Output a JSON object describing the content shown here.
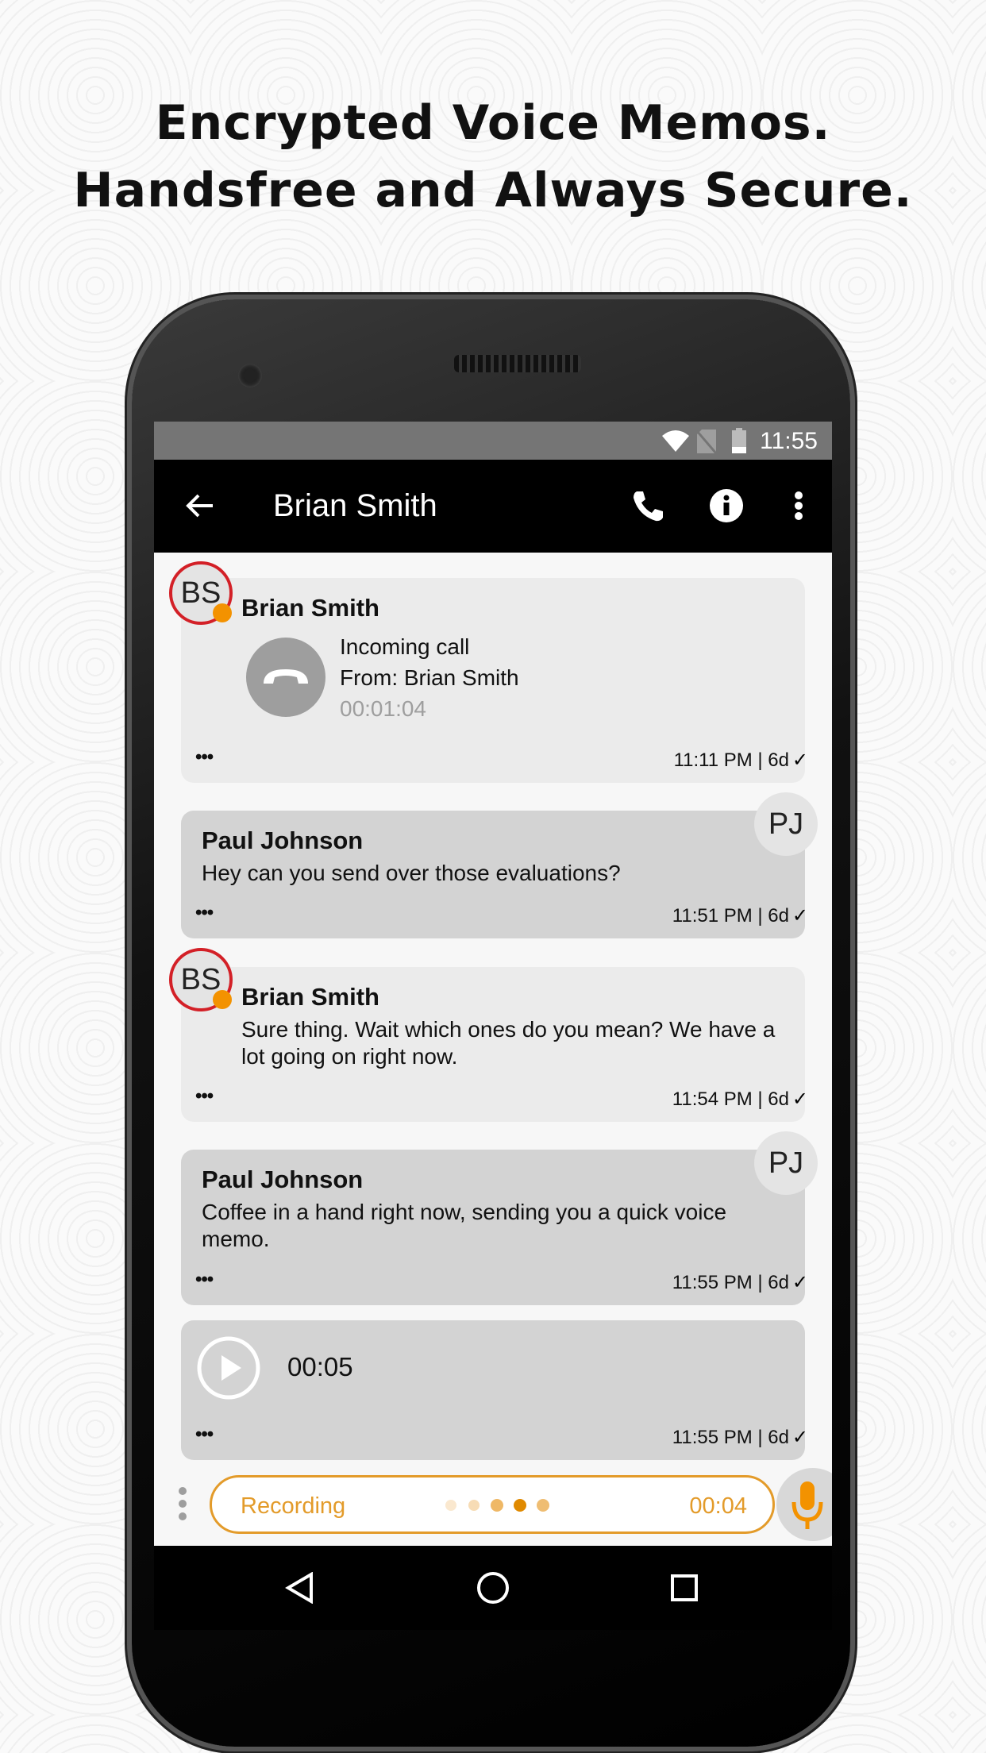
{
  "headline": {
    "line1": "Encrypted Voice Memos.",
    "line2": "Handsfree and Always Secure."
  },
  "status_bar": {
    "time": "11:55",
    "icons": [
      "wifi-icon",
      "no-sim-icon",
      "battery-icon"
    ]
  },
  "app_bar": {
    "title": "Brian Smith",
    "icons": [
      "back-arrow-icon",
      "phone-icon",
      "info-icon",
      "more-vert-icon"
    ]
  },
  "messages": [
    {
      "sender": "Brian Smith",
      "initials": "BS",
      "type": "call",
      "line1": "Incoming call",
      "line2": "From: Brian Smith",
      "duration": "00:01:04",
      "timestamp": "11:11 PM | 6d",
      "more": "•••"
    },
    {
      "sender": "Paul Johnson",
      "initials": "PJ",
      "text": "Hey can you send over those evaluations?",
      "timestamp": "11:51 PM | 6d",
      "more": "•••"
    },
    {
      "sender": "Brian Smith",
      "initials": "BS",
      "text": "Sure thing. Wait which ones do you mean? We have a lot going on right now.",
      "timestamp": "11:54 PM | 6d",
      "more": "•••"
    },
    {
      "sender": "Paul Johnson",
      "initials": "PJ",
      "text": "Coffee in a hand right now, sending you a quick voice memo.",
      "timestamp": "11:55 PM | 6d",
      "more": "•••"
    },
    {
      "type": "voice",
      "duration": "00:05",
      "timestamp": "11:55 PM | 6d",
      "more": "•••"
    }
  ],
  "composer": {
    "status": "Recording",
    "elapsed": "00:04"
  },
  "colors": {
    "accent": "#e39b2a",
    "presence": "#f39200",
    "avatar_ring": "#d32027",
    "appbar": "#000000",
    "statusbar": "#757575"
  }
}
